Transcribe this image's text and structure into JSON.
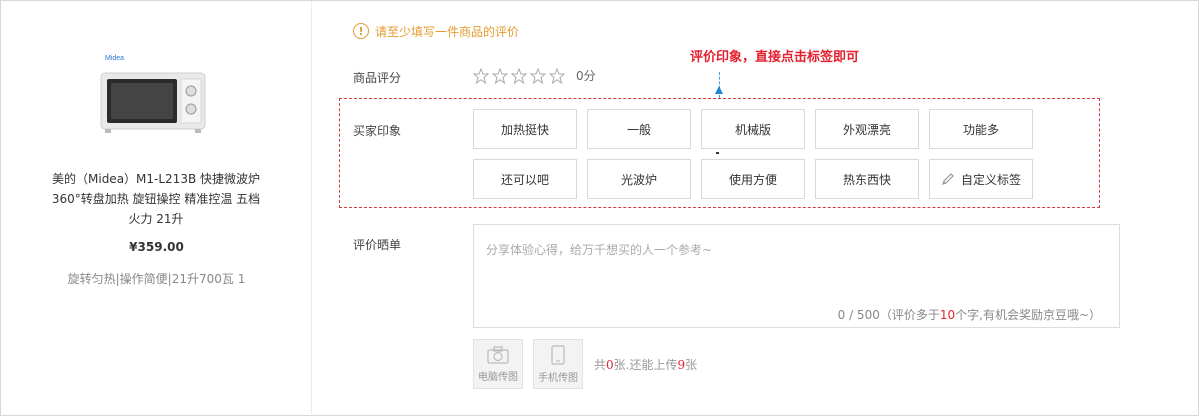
{
  "product": {
    "brand_logo": "Midea",
    "name_line1": "美的（Midea）M1-L213B 快捷微波炉",
    "name_line2": "360°转盘加热 旋钮操控 精准控温 五档",
    "name_line3": "火力 21升",
    "price": "¥359.00",
    "tags": "旋转匀热|操作简便|21升700瓦 1"
  },
  "tip": {
    "icon": "!",
    "text": "请至少填写一件商品的评价"
  },
  "annotation": {
    "text": "评价印象，直接点击标签即可"
  },
  "rating": {
    "label": "商品评分",
    "stars_total": 5,
    "stars_filled": 0,
    "score_text": "0分"
  },
  "impression": {
    "label": "买家印象",
    "tags_row1": [
      "加热挺快",
      "一般",
      "机械版",
      "外观漂亮",
      "功能多"
    ],
    "tags_row2": [
      "还可以吧",
      "光波炉",
      "使用方便",
      "热东西快"
    ],
    "custom_tag_label": "自定义标签",
    "custom_tag_icon": "pencil-icon"
  },
  "review": {
    "label": "评价晒单",
    "placeholder": "分享体验心得，给万千想买的人一个参考~",
    "counter_prefix": "0 / 500（评价多于",
    "counter_num": "10",
    "counter_suffix": "个字,有机会奖励京豆哦~）"
  },
  "upload": {
    "pc_label": "电脑传图",
    "mobile_label": "手机传图",
    "info_prefix": "共",
    "count": "0",
    "info_mid": "张.还能上传",
    "remaining": "9",
    "info_suffix": "张"
  },
  "colors": {
    "accent_red": "#e4202f",
    "tip_orange": "#e59a2f",
    "arrow_blue": "#1f86d3"
  }
}
